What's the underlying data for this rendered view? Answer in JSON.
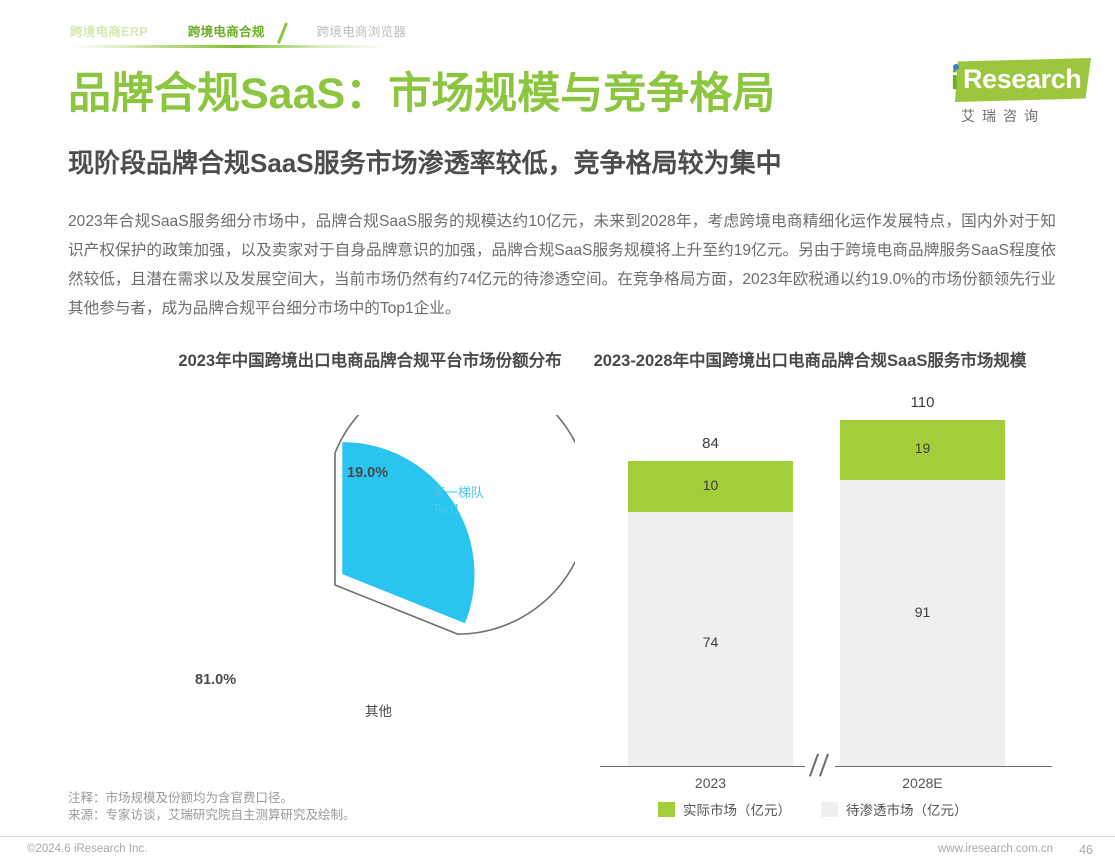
{
  "nav": {
    "tabs": [
      {
        "label": "跨境电商ERP",
        "state": "inactive-light"
      },
      {
        "label": "跨境电商合规",
        "state": "active"
      },
      {
        "label": "跨境电商浏览器",
        "state": "inactive-gray"
      }
    ]
  },
  "logo": {
    "i": "i",
    "word": "Research",
    "cn": "艾瑞咨询",
    "green": "#9cc63d",
    "blue_dot": "#3b7fc4"
  },
  "headings": {
    "title": "品牌合规SaaS：市场规模与竞争格局",
    "subtitle": "现阶段品牌合规SaaS服务市场渗透率较低，竞争格局较为集中",
    "title_color": "#8cc63e"
  },
  "body": {
    "paragraph": "2023年合规SaaS服务细分市场中，品牌合规SaaS服务的规模达约10亿元，未来到2028年，考虑跨境电商精细化运作发展特点，国内外对于知识产权保护的政策加强，以及卖家对于自身品牌意识的加强，品牌合规SaaS服务规模将上升至约19亿元。另由于跨境电商品牌服务SaaS程度依然较低，且潜在需求以及发展空间大，当前市场仍然有约74亿元的待渗透空间。在竞争格局方面，2023年欧税通以约19.0%的市场份额领先行业其他参与者，成为品牌合规平台细分市场中的Top1企业。"
  },
  "chart_titles": {
    "left": "2023年中国跨境出口电商品牌合规平台市场份额分布",
    "right": "2023-2028年中国跨境出口电商品牌合规SaaS服务市场规模"
  },
  "chart_data": [
    {
      "type": "pie",
      "title": "2023年中国跨境出口电商品牌合规平台市场份额分布",
      "categories": [
        "第一梯队 Top1",
        "其他"
      ],
      "values": [
        19.0,
        81.0
      ],
      "value_labels": [
        "19.0%",
        "81.0%"
      ],
      "slice_labels": [
        "第一梯队\nTop1",
        "其他"
      ],
      "label_line1": "第一梯队",
      "label_line2": "Top1",
      "other_label": "其他",
      "colors": [
        "#29c5ee",
        "#ffffff"
      ],
      "exploded_slice": 0,
      "legend": "none"
    },
    {
      "type": "bar",
      "subtype": "stacked",
      "title": "2023-2028年中国跨境出口电商品牌合规SaaS服务市场规模",
      "categories": [
        "2023",
        "2028E"
      ],
      "totals": [
        84,
        110
      ],
      "series": [
        {
          "name": "实际市场（亿元）",
          "values": [
            10,
            19
          ],
          "color": "#a4ce39"
        },
        {
          "name": "待渗透市场（亿元）",
          "values": [
            74,
            91
          ],
          "color": "#efefef"
        }
      ],
      "legend": [
        "实际市场（亿元）",
        "待渗透市场（亿元）"
      ],
      "legend_position": "bottom",
      "xlabel": "",
      "ylabel": "",
      "axis_break": true,
      "grid": false
    }
  ],
  "notes": {
    "line1": "注释：市场规模及份额均为含官费口径。",
    "line2": "来源：专家访谈，艾瑞研究院自主测算研究及绘制。"
  },
  "footer": {
    "copyright": "©2024.6 iResearch Inc.",
    "url": "www.iresearch.com.cn",
    "page": "46"
  }
}
